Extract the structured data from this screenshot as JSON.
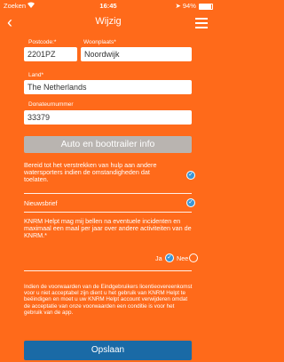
{
  "status": {
    "carrier": "Zoeken",
    "time": "16:45",
    "battery": "94%"
  },
  "header": {
    "title": "Wijzig"
  },
  "form": {
    "postcode_label": "Postcode:*",
    "postcode_value": "2201PZ",
    "city_label": "Woonplaats*",
    "city_value": "Noordwijk",
    "country_label": "Land*",
    "country_value": "The Netherlands",
    "donor_label": "Donateurnummer",
    "donor_value": "33379",
    "trailer_button": "Auto en boottrailer info"
  },
  "options": {
    "help_text": "Bereid tot het verstrekken van hulp aan andere watersporters indien de omstandigheden dat toelaten.",
    "newsletter_label": "Nieuwsbrief",
    "call_text": "KNRM Helpt mag mij bellen na eventuele incidenten en maximaal een maal per jaar over andere activiteiten van de KNRM.*",
    "yes_label": "Ja",
    "no_label": "Nee"
  },
  "terms": {
    "text": "Indien de voorwaarden van de Eindgebruikers licentieovereenkomst voor u niet acceptabel zijn dient u het gebruik van KNRM Helpt te beëindigen en moet u uw KNRM Helpt account verwijderen omdat de acceptatie van onze voorwaarden een conditie is voor het gebruik van de app."
  },
  "footer": {
    "save_label": "Opslaan"
  },
  "colors": {
    "background": "#ff6a1a",
    "check": "#3a95d6",
    "save": "#1a6aa6",
    "disabled": "#b9b4b0"
  },
  "indicators": {
    "battery_level": 0.94,
    "help_checked": true,
    "newsletter_checked": true,
    "call_permission": "Ja"
  }
}
